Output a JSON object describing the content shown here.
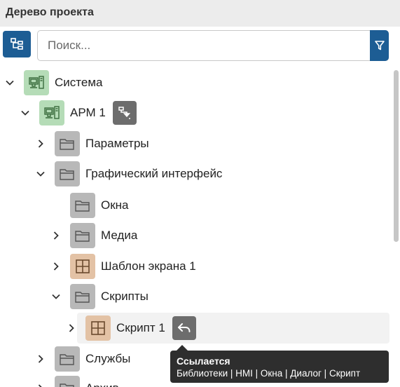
{
  "header": {
    "title": "Дерево проекта"
  },
  "search": {
    "placeholder": "Поиск..."
  },
  "toolbar": {
    "tree_icon": "hierarchy-icon",
    "filter_icon": "filter-icon"
  },
  "tree": {
    "nodes": [
      {
        "label": "Система",
        "icon": "workstation-icon",
        "expanded": true
      },
      {
        "label": "АРМ 1",
        "icon": "workstation-icon",
        "expanded": true,
        "badge": "download-icon"
      },
      {
        "label": "Параметры",
        "icon": "folder-icon",
        "expanded": false
      },
      {
        "label": "Графический интерфейс",
        "icon": "folder-icon",
        "expanded": true
      },
      {
        "label": "Окна",
        "icon": "folder-icon"
      },
      {
        "label": "Медиа",
        "icon": "folder-icon",
        "expanded": false
      },
      {
        "label": "Шаблон экрана 1",
        "icon": "grid-icon",
        "expanded": false
      },
      {
        "label": "Скрипты",
        "icon": "folder-icon",
        "expanded": true
      },
      {
        "label": "Скрипт 1",
        "icon": "grid-icon",
        "expanded": false,
        "selected": true,
        "badge": "reply-icon"
      },
      {
        "label": "Службы",
        "icon": "folder-icon",
        "expanded": false
      },
      {
        "label": "Архив",
        "icon": "folder-icon",
        "expanded": false
      }
    ]
  },
  "tooltip": {
    "title": "Ссылается",
    "body": "Библиотеки | HMI | Окна | Диалог | Скрипт"
  },
  "colors": {
    "accent": "#1d5d94",
    "header_bg": "#ececec",
    "green_icon_bg": "#b5dcb7",
    "gray_icon_bg": "#b8b8b8",
    "tan_icon_bg": "#e3c2a5",
    "badge_bg": "#6d6d6d",
    "tooltip_bg": "#2e2e2e"
  }
}
